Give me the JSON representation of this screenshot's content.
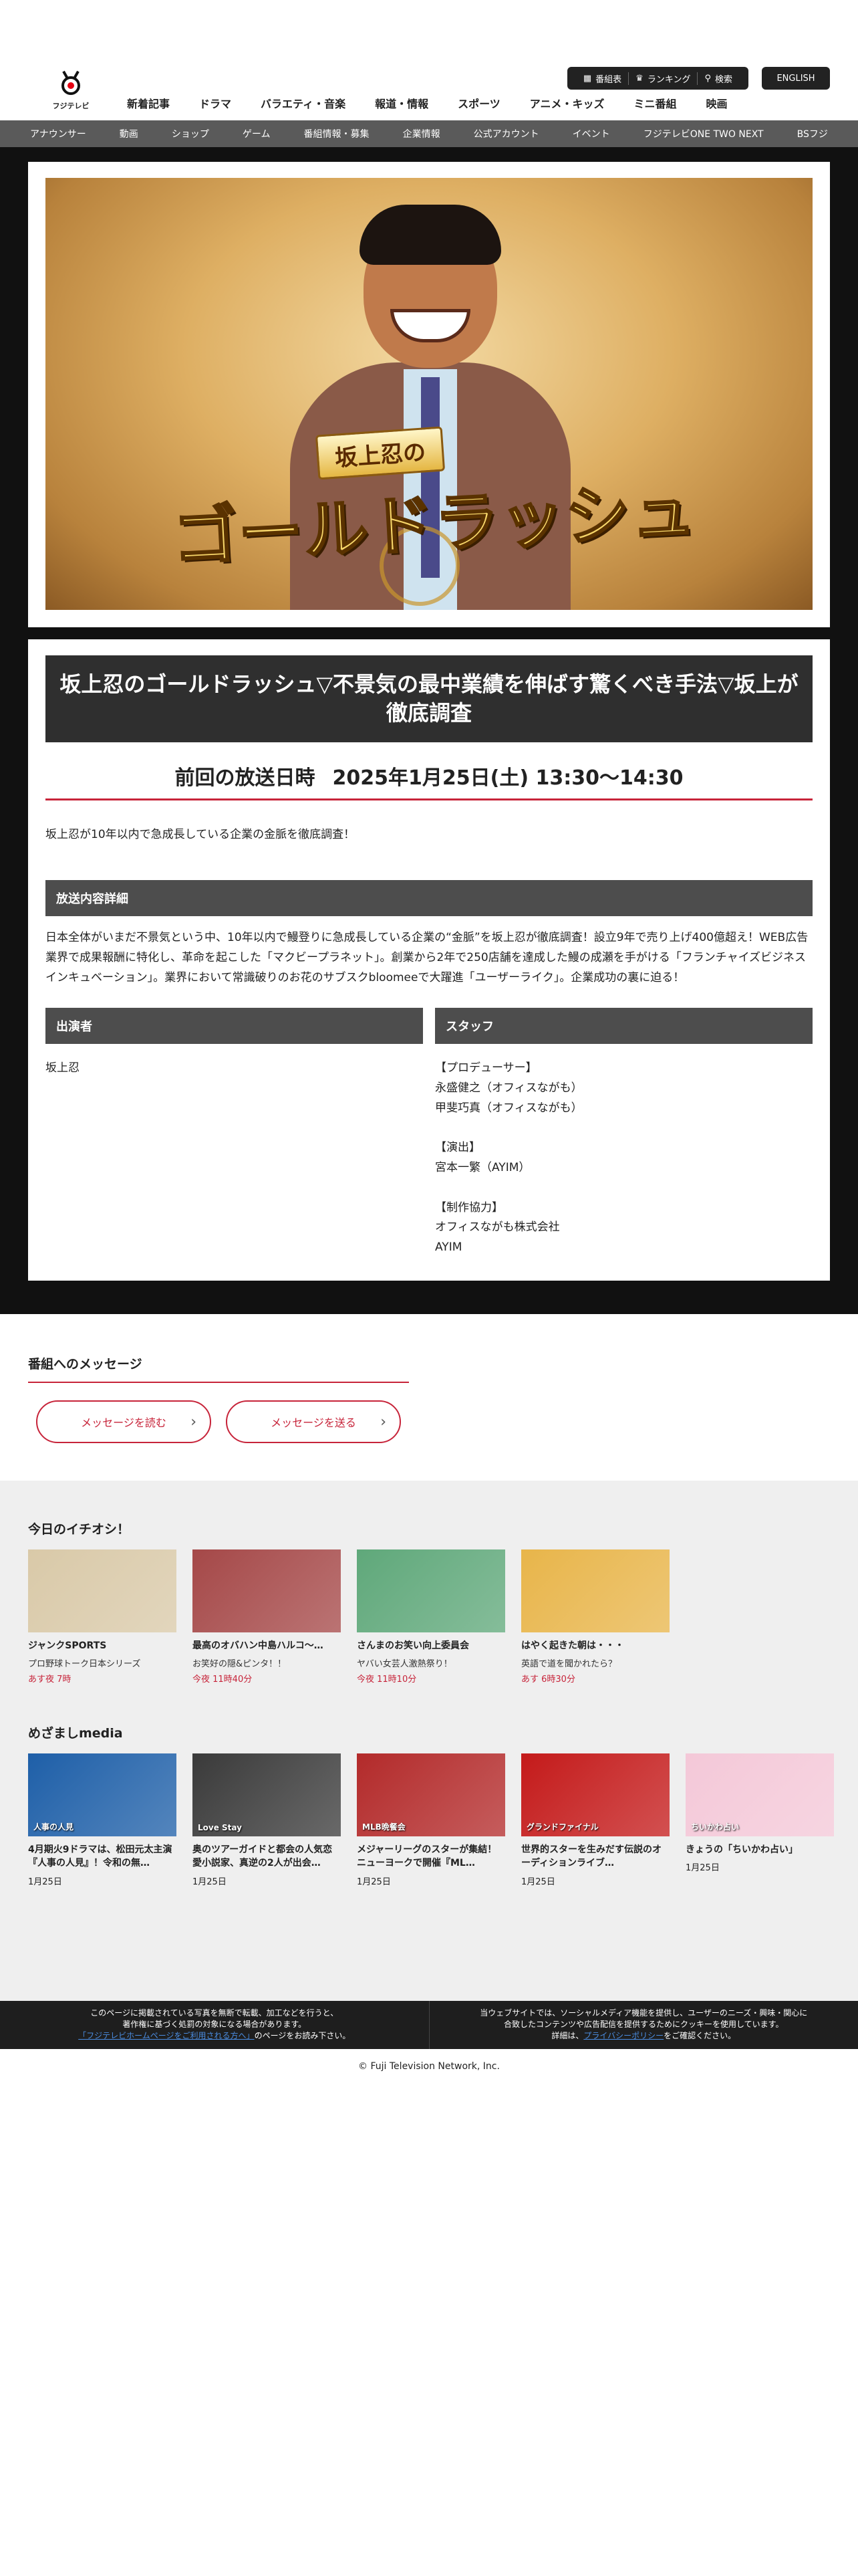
{
  "header": {
    "logo_text": "フジテレビ",
    "util": [
      "番組表",
      "ランキング",
      "検索"
    ],
    "english": "ENGLISH",
    "main_nav": [
      "新着記事",
      "ドラマ",
      "バラエティ・音楽",
      "報道・情報",
      "スポーツ",
      "アニメ・キッズ",
      "ミニ番組",
      "映画"
    ],
    "sub_nav": [
      "アナウンサー",
      "動画",
      "ショップ",
      "ゲーム",
      "番組情報・募集",
      "企業情報",
      "公式アカウント",
      "イベント",
      "フジテレビONE TWO NEXT",
      "BSフジ"
    ]
  },
  "hero": {
    "title_small": "坂上忍の",
    "title_big": "ゴールドラッシュ"
  },
  "program": {
    "title": "坂上忍のゴールドラッシュ▽不景気の最中業績を伸ばす驚くべき手法▽坂上が徹底調査",
    "broadcast_label": "前回の放送日時",
    "broadcast_value": "2025年1月25日(土) 13:30〜14:30",
    "lead": "坂上忍が10年以内で急成長している企業の金脈を徹底調査！",
    "detail_head": "放送内容詳細",
    "detail": "日本全体がいまだ不景気という中、10年以内で鰻登りに急成長している企業の“金脈”を坂上忍が徹底調査！設立9年で売り上げ400億超え！WEB広告業界で成果報酬に特化し、革命を起こした「マクビープラネット」。創業から2年で250店舗を達成した鰻の成瀬を手がける「フランチャイズビジネスインキュベーション」。業界において常識破りのお花のサブスクbloomeeで大躍進「ユーザーライク」。企業成功の裏に迫る！",
    "cast_head": "出演者",
    "cast": "坂上忍",
    "staff_head": "スタッフ",
    "staff": "【プロデューサー】\n永盛健之（オフィスながも）\n甲斐巧真（オフィスながも）\n\n【演出】\n宮本一繁（AYIM）\n\n【制作協力】\nオフィスながも株式会社\nAYIM"
  },
  "message": {
    "head": "番組へのメッセージ",
    "read": "メッセージを読む",
    "send": "メッセージを送る"
  },
  "recommend": {
    "head": "今日のイチオシ！",
    "cards": [
      {
        "title": "ジャンクSPORTS",
        "sub": "プロ野球トーク日本シリーズ",
        "time": "あす夜 7時",
        "bg": "#d9c9a8"
      },
      {
        "title": "最高のオバハン中島ハルコ〜…",
        "sub": "お笑好の隠&ピンタ！！",
        "time": "今夜 11時40分",
        "bg": "#a54848"
      },
      {
        "title": "さんまのお笑い向上委員会",
        "sub": "ヤバい女芸人激熱祭り！",
        "time": "今夜 11時10分",
        "bg": "#5fa87a"
      },
      {
        "title": "はやく起きた朝は・・・",
        "sub": "英語で道を聞かれたら？",
        "time": "あす 6時30分",
        "bg": "#e8b54a"
      }
    ]
  },
  "media": {
    "head": "めざましmedia",
    "cards": [
      {
        "title": "4月期火9ドラマは、松田元太主演『人事の人見』！令和の無…",
        "date": "1月25日",
        "bg": "#1e5fa8",
        "label": "人事の人見"
      },
      {
        "title": "奥のツアーガイドと都会の人気恋愛小説家、真逆の2人が出会…",
        "date": "1月25日",
        "bg": "#3a3a3a",
        "label": "Love Stay"
      },
      {
        "title": "メジャーリーグのスターが集結！ニューヨークで開催『ML…",
        "date": "1月25日",
        "bg": "#b32a2a",
        "label": "MLB晩餐会"
      },
      {
        "title": "世界的スターを生みだす伝説のオーディションライブ…",
        "date": "1月25日",
        "bg": "#c41a1a",
        "label": "グランドファイナル"
      },
      {
        "title": "きょうの「ちいかわ占い」",
        "date": "1月25日",
        "bg": "#f4c8d8",
        "label": "ちいかわ占い"
      }
    ]
  },
  "footer": {
    "left_1": "このページに掲載されている写真を無断で転載、加工などを行うと、",
    "left_2": "著作権に基づく処罰の対象になる場合があります。",
    "left_link": "「フジテレビホームページをご利用される方へ」",
    "left_3": "のページをお読み下さい。",
    "right_1": "当ウェブサイトでは、ソーシャルメディア機能を提供し、ユーザーのニーズ・興味・関心に",
    "right_2": "合致したコンテンツや広告配信を提供するためにクッキーを使用しています。",
    "right_3": "詳細は、",
    "right_link": "プライバシーポリシー",
    "right_4": "をご確認ください。",
    "copyright": "© Fuji Television Network, Inc."
  }
}
